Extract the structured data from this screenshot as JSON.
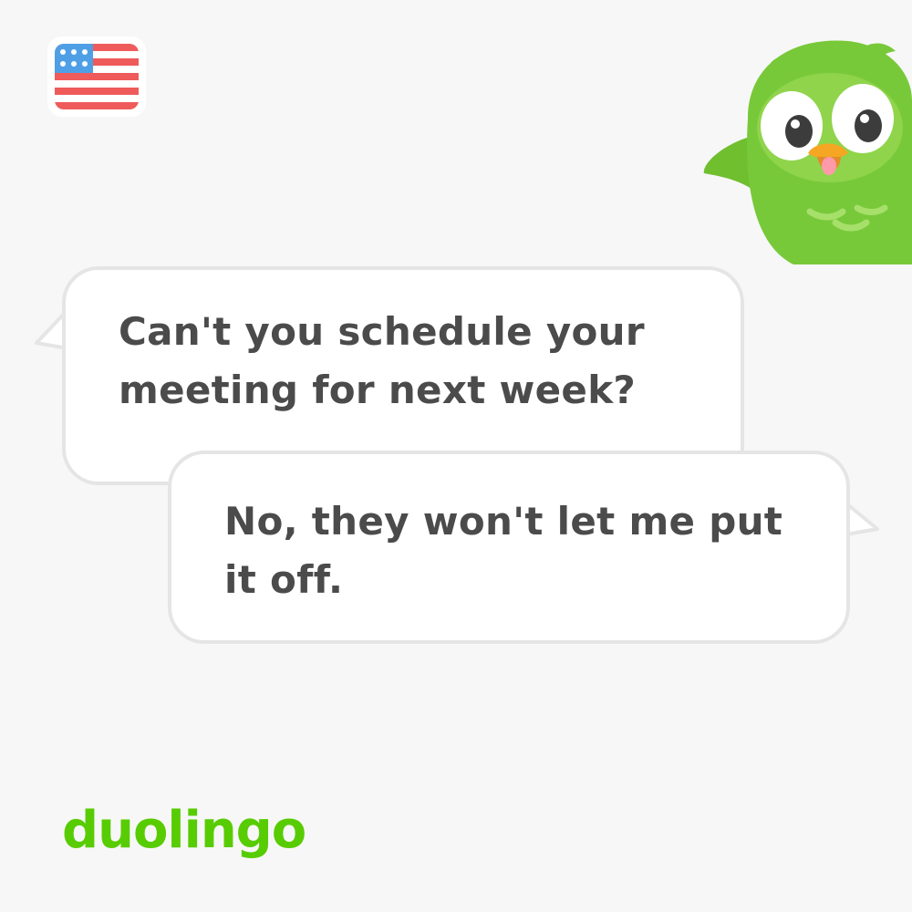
{
  "language_flag": {
    "icon": "us-flag-icon"
  },
  "mascot": {
    "icon": "owl-mascot-icon"
  },
  "conversation": {
    "messages": [
      {
        "speaker": "left",
        "text": "Can't you schedule your meeting for next week?"
      },
      {
        "speaker": "right",
        "text": "No, they won't let me put it off."
      }
    ]
  },
  "brand": {
    "logo_text": "duolingo"
  },
  "colors": {
    "background": "#f7f7f7",
    "bubble_fill": "#ffffff",
    "bubble_border": "#e5e5e5",
    "text": "#4b4b4b",
    "brand_green": "#58cc02",
    "owl_green": "#78c93a",
    "flag_red": "#ef5b5b",
    "flag_blue": "#4f9fe6"
  }
}
